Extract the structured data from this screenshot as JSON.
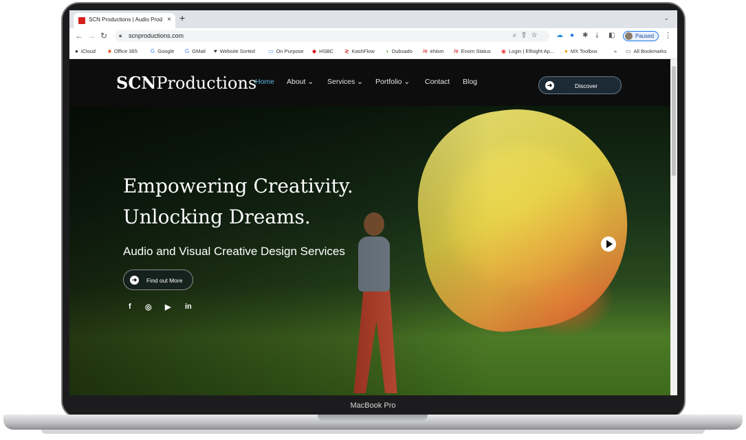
{
  "browser": {
    "tab_title": "SCN Productions | Audio Prod",
    "tab_close": "×",
    "new_tab": "+",
    "url": "scnproductions.com",
    "profile_status": "Paused",
    "bookmarks": [
      "iCloud",
      "Office 365",
      "Google",
      "GMail",
      "Website Sorted",
      "On Purpose",
      "HSBC",
      "KashFlow",
      "Dubsado",
      "eNom",
      "Enom Status",
      "Login | Elfsight Ap...",
      "MX Toolbox",
      "All Bookmarks"
    ],
    "bookmarks_overflow": "»"
  },
  "site": {
    "logo_bold": "SCN",
    "logo_light": "Productions",
    "nav": [
      "Home",
      "About ⌄",
      "Services ⌄",
      "Portfolio ⌄",
      "Contact",
      "Blog"
    ],
    "discover_label": "Discover",
    "hero": {
      "title_line1": "Empowering Creativity.",
      "title_line2": "Unlocking Dreams.",
      "subtitle": "Audio and Visual Creative Design Services",
      "cta_label": "Find out More"
    },
    "social": [
      "f",
      "◎",
      "▶",
      "in"
    ]
  },
  "device_label": "MacBook Pro",
  "colors": {
    "accent": "#5db4e6",
    "header_bg": "#0d0d0d",
    "brand_red": "#d6201b"
  }
}
